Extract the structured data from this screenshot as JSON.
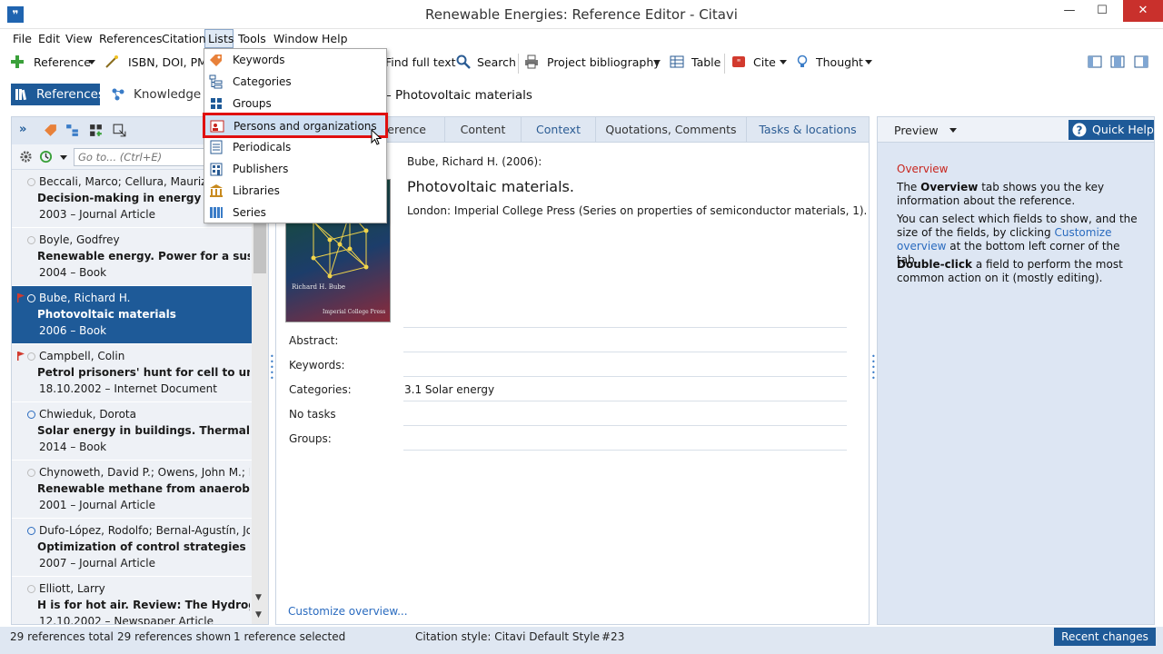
{
  "window": {
    "title": "Renewable Energies: Reference Editor - Citavi"
  },
  "menu": [
    "File",
    "Edit",
    "View",
    "References",
    "Citation",
    "Lists",
    "Tools",
    "Window",
    "Help"
  ],
  "toolbar": {
    "reference": "Reference",
    "isbn": "ISBN, DOI, PMID",
    "find_full_text": "Find full text",
    "search": "Search",
    "project_bibliography": "Project bibliography",
    "table": "Table",
    "cite": "Cite",
    "thought": "Thought"
  },
  "modes": {
    "references": "References",
    "knowledge": "Knowledge"
  },
  "current_reference_title": "– Photovoltaic materials",
  "search": {
    "placeholder": "Go to... (Ctrl+E)"
  },
  "references": [
    {
      "author": "Beccali, Marco; Cellura, Maurizio; Mistretta, Marina",
      "title": "Decision-making in energy planning",
      "meta": "2003 – Journal Article",
      "flag": false,
      "circle": "grey"
    },
    {
      "author": "Boyle, Godfrey",
      "title": "Renewable energy. Power for a sustainable future",
      "meta": "2004 – Book",
      "flag": false,
      "circle": "grey"
    },
    {
      "author": "Bube, Richard H.",
      "title": "Photovoltaic materials",
      "meta": "2006 – Book",
      "flag": true,
      "circle": "blue",
      "selected": true
    },
    {
      "author": "Campbell, Colin",
      "title": "Petrol prisoners' hunt for cell to unblock",
      "meta": "18.10.2002 – Internet Document",
      "flag": true,
      "circle": "grey"
    },
    {
      "author": "Chwieduk, Dorota",
      "title": "Solar energy in buildings. Thermal balance",
      "meta": "2014 – Book",
      "flag": false,
      "circle": "blue"
    },
    {
      "author": "Chynoweth, David P.; Owens, John M.; Legrand",
      "title": "Renewable methane from anaerobic digestion",
      "meta": "2001 – Journal Article",
      "flag": false,
      "circle": "grey"
    },
    {
      "author": "Dufo-López, Rodolfo; Bernal-Agustín, José",
      "title": "Optimization of control strategies for stand-alone",
      "meta": "2007 – Journal Article",
      "flag": false,
      "circle": "blue"
    },
    {
      "author": "Elliott, Larry",
      "title": "H is for hot air. Review: The Hydrogen Economy",
      "meta": "12.10.2002 – Newspaper Article",
      "flag": false,
      "circle": "grey"
    }
  ],
  "tabs": [
    "Reference",
    "Content",
    "Context",
    "Quotations, Comments",
    "Tasks & locations"
  ],
  "overview": {
    "citation_line": "Bube, Richard H. (2006):",
    "title": "Photovoltaic materials.",
    "publisher": "London: Imperial College Press (Series on properties of semiconductor materials, 1).",
    "cover_author": "Richard H. Bube",
    "cover_publisher": "Imperial College Press",
    "fields": [
      {
        "label": "Abstract:",
        "value": ""
      },
      {
        "label": "Keywords:",
        "value": ""
      },
      {
        "label": "Categories:",
        "value": "3.1 Solar energy"
      },
      {
        "label": "No tasks",
        "value": ""
      },
      {
        "label": "Groups:",
        "value": ""
      }
    ],
    "customize_link": "Customize overview..."
  },
  "help": {
    "preview_label": "Preview",
    "quick_help": "Quick Help",
    "heading": "Overview",
    "p1_pre": "The ",
    "p1_bold": "Overview",
    "p1_post": " tab shows you the key information about the reference.",
    "p2_pre": "You can select which fields to show, and the size of the fields, by clicking ",
    "p2_link": "Customize overview",
    "p2_post": " at the bottom left corner of the tab.",
    "p3_bold": "Double-click",
    "p3_post": " a field to perform the most common action on it (mostly editing)."
  },
  "status": {
    "total": "29 references total",
    "shown": "29 references shown",
    "selected": "1 reference selected",
    "citation_style": "Citation style: Citavi Default Style",
    "number": "#23",
    "recent_changes": "Recent changes"
  },
  "lists_menu": [
    "Keywords",
    "Categories",
    "Groups",
    "Persons and organizations",
    "Periodicals",
    "Publishers",
    "Libraries",
    "Series"
  ],
  "colors": {
    "accent": "#1e5a98",
    "highlight_frame": "#e01010"
  }
}
